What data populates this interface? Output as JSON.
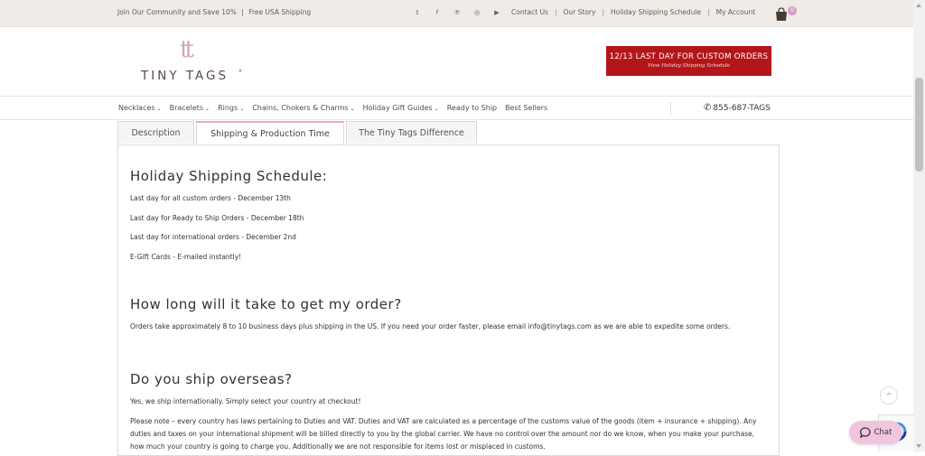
{
  "topbar": {
    "community": "Join Our Community and Save 10%",
    "separator": "|",
    "shipping": "Free USA Shipping",
    "social": [
      {
        "icon": "twitter-icon",
        "glyph": "𝕥"
      },
      {
        "icon": "facebook-icon",
        "glyph": "f"
      },
      {
        "icon": "pinterest-icon",
        "glyph": "℗"
      },
      {
        "icon": "instagram-icon",
        "glyph": "◎"
      },
      {
        "icon": "youtube-icon",
        "glyph": "▶"
      }
    ],
    "links": [
      "Contact Us",
      "Our Story",
      "Holiday Shipping Schedule",
      "My Account"
    ],
    "link_divider": "|",
    "cart_count": "0"
  },
  "header": {
    "logo_mark": "tt",
    "logo_text": "TINY TAGS",
    "logo_tm": "®",
    "banner_line1": "12/13 LAST DAY FOR CUSTOM ORDERS",
    "banner_line2": "View Holiday Shipping Schedule"
  },
  "nav": {
    "items": [
      {
        "label": "Necklaces",
        "chevron": true
      },
      {
        "label": "Bracelets",
        "chevron": true
      },
      {
        "label": "Rings",
        "chevron": true
      },
      {
        "label": "Chains, Chokers & Charms",
        "chevron": true
      },
      {
        "label": "Holiday Gift Guides",
        "chevron": true
      },
      {
        "label": "Ready to Ship",
        "chevron": false
      },
      {
        "label": "Best Sellers",
        "chevron": false
      }
    ],
    "phone": "855-687-TAGS"
  },
  "tabs": {
    "description": "Description",
    "shipping": "Shipping & Production Time",
    "difference": "The Tiny Tags Difference"
  },
  "content": {
    "holiday_heading": "Holiday Shipping Schedule:",
    "holiday_lines": [
      "Last day for all custom orders - December 13th",
      "Last day for Ready to Ship Orders - December 18th",
      "Last day for international orders - December 2nd",
      "E-Gift Cards - E-mailed instantly!"
    ],
    "howlong_heading": "How long will it take to get my order?",
    "howlong_text": "Orders take approximately 8 to 10 business days plus shipping in the US. If you need your order faster, please email info@tinytags.com as we are able to expedite some orders.",
    "overseas_heading": "Do you ship overseas?",
    "overseas_text": "Yes, we ship internationally. Simply select your country at checkout!",
    "overseas_note": "Please note – every country has laws pertaining to Duties and VAT. Duties and VAT are calculated as a percentage of the customs value of the goods (item + insurance + shipping). Any duties and taxes on your international shipment will be billed directly to you by the global carrier. We have no control over the amount nor do we know, when you make your purchase, how much your country is going to charge you. Additionally we are not responsible for items lost or misplaced in customs."
  },
  "widgets": {
    "chat_label": "Chat",
    "back_to_top": "^"
  },
  "colors": {
    "topbar_bg": "#efebe7",
    "accent_pink": "#e7a9c9",
    "banner_red": "#b3161a",
    "chat_bg": "#f1c5de"
  }
}
